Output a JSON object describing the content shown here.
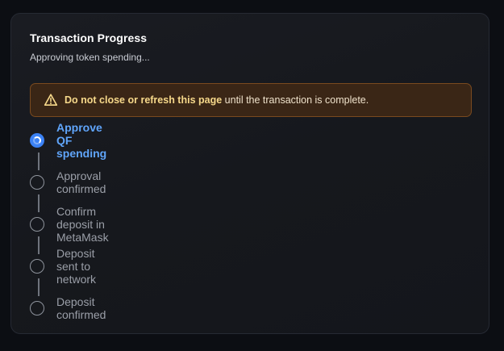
{
  "card": {
    "title": "Transaction Progress",
    "subtitle": "Approving token spending..."
  },
  "warning": {
    "icon": "warning-triangle-icon",
    "bold_text": "Do not close or refresh this page",
    "rest_text": " until the transaction is complete.",
    "colors": {
      "background": "#3a2616",
      "border": "#7a4a1f",
      "emphasis": "#f6d88a"
    }
  },
  "steps": [
    {
      "label": "Approve QF spending",
      "status": "active"
    },
    {
      "label": "Approval confirmed",
      "status": "pending"
    },
    {
      "label": "Confirm deposit in MetaMask",
      "status": "pending"
    },
    {
      "label": "Deposit sent to network",
      "status": "pending"
    },
    {
      "label": "Deposit confirmed",
      "status": "pending"
    }
  ],
  "colors": {
    "active": "#60a5fa",
    "active_dot": "#3b82f6",
    "pending": "#9b9fa8"
  }
}
